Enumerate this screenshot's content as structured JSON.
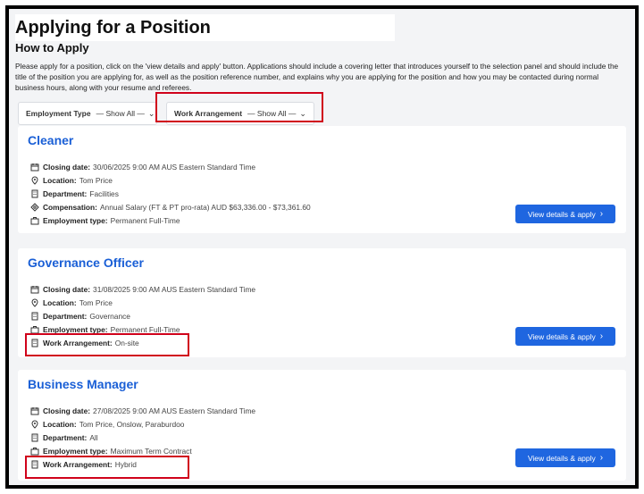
{
  "page": {
    "title": "Applying for a Position",
    "section_title": "How to Apply",
    "intro": "Please apply for a position, click on the 'view details and apply' button. Applications should include a covering letter that introduces yourself to the selection panel and should include the title of the position you are applying for, as well as the position reference number, and explains why you are applying for the position and how you may be contacted during normal business hours, along with your resume and referees."
  },
  "filters": [
    {
      "label": "Employment Type",
      "value": "— Show All —"
    },
    {
      "label": "Work Arrangement",
      "value": "— Show All —"
    }
  ],
  "apply_label": "View details & apply",
  "jobs": [
    {
      "title": "Cleaner",
      "rows": [
        {
          "key": "Closing date:",
          "value": "30/06/2025 9:00 AM AUS Eastern Standard Time",
          "icon": "calendar-icon"
        },
        {
          "key": "Location:",
          "value": "Tom Price",
          "icon": "location-pin-icon"
        },
        {
          "key": "Department:",
          "value": "Facilities",
          "icon": "building-icon"
        },
        {
          "key": "Compensation:",
          "value": "Annual Salary (FT & PT pro-rata) AUD $63,336.00 - $73,361.60",
          "icon": "money-icon"
        },
        {
          "key": "Employment type:",
          "value": "Permanent Full-Time",
          "icon": "briefcase-icon"
        }
      ]
    },
    {
      "title": "Governance Officer",
      "rows": [
        {
          "key": "Closing date:",
          "value": "31/08/2025 9:00 AM AUS Eastern Standard Time",
          "icon": "calendar-icon"
        },
        {
          "key": "Location:",
          "value": "Tom Price",
          "icon": "location-pin-icon"
        },
        {
          "key": "Department:",
          "value": "Governance",
          "icon": "building-icon"
        },
        {
          "key": "Employment type:",
          "value": "Permanent Full-Time",
          "icon": "briefcase-icon"
        },
        {
          "key": "Work Arrangement:",
          "value": "On-site",
          "icon": "building-icon"
        }
      ]
    },
    {
      "title": "Business Manager",
      "rows": [
        {
          "key": "Closing date:",
          "value": "27/08/2025 9:00 AM AUS Eastern Standard Time",
          "icon": "calendar-icon"
        },
        {
          "key": "Location:",
          "value": "Tom Price, Onslow, Paraburdoo",
          "icon": "location-pin-icon"
        },
        {
          "key": "Department:",
          "value": "All",
          "icon": "building-icon"
        },
        {
          "key": "Employment type:",
          "value": "Maximum Term Contract",
          "icon": "briefcase-icon"
        },
        {
          "key": "Work Arrangement:",
          "value": "Hybrid",
          "icon": "building-icon"
        }
      ]
    }
  ],
  "colors": {
    "accent": "#1f66e0",
    "link": "#1a5fd6",
    "highlight": "#d0021b"
  }
}
